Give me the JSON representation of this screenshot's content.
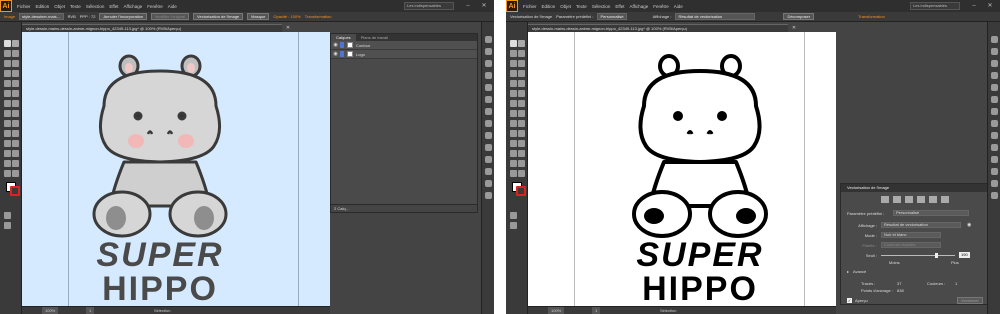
{
  "left": {
    "app_logo": "Ai",
    "menu": [
      "Fichier",
      "Edition",
      "Objet",
      "Texte",
      "Sélection",
      "Effet",
      "Affichage",
      "Fenêtre",
      "Aide"
    ],
    "workspace": "Les indispensables",
    "control": {
      "label": "Image",
      "filename": "style-dessiner-mais…",
      "color_mode": "RVB",
      "ppi": "PPP : 72",
      "btn_annuler": "Annuler l'incorporation",
      "btn_modifier": "Modifier l'original",
      "btn_vector": "Vectorisation de l'image",
      "btn_masque": "Masque",
      "opacity": "Opacité : 100%",
      "transform": "Transformation"
    },
    "doc_tab": "style-dessin-mains-dessin-anime-mignon-hippo_42349-113.jpg* @ 100% (RVB/Aperçu)",
    "status": {
      "zoom": "100%",
      "page": "1",
      "tool": "Sélection"
    },
    "layers_panel": {
      "tabs": [
        "Calques",
        "Plans de travail"
      ],
      "rows": [
        "Contour",
        "Logo"
      ],
      "footer": "2 Calq…"
    },
    "art_text": [
      "SUPER",
      "HIPPO"
    ]
  },
  "right": {
    "control": {
      "label": "Vectorisation de l'image",
      "preset_label": "Paramètre prédéfini :",
      "preset_value": "Personnalisé",
      "view_label": "Affichage :",
      "view_value": "Résultat de vectorisation",
      "btn_decomposer": "Décomposer",
      "transform": "Transformation"
    },
    "doc_tab": "style-dessin-mains-dessin-anime-mignon-hippo_42349-113.jpg* @ 100% (RVB/Aperçu)",
    "status": {
      "zoom": "100%",
      "page": "1",
      "tool": "Sélection"
    },
    "trace_panel": {
      "title": "Vectorisation de l'image",
      "preset_label": "Paramètre prédéfini :",
      "preset_value": "Personnalisé",
      "view_label": "Affichage :",
      "view_value": "Résultat de vectorisation",
      "mode_label": "Mode :",
      "mode_value": "Noir et blanc",
      "palette_label": "Palette :",
      "palette_value": "Couleurs réduites",
      "threshold_label": "Seuil :",
      "threshold_value": "190",
      "threshold_min": "Moins",
      "threshold_max": "Plus",
      "advanced": "Avancé",
      "paths_label": "Tracés :",
      "paths_value": "37",
      "colors_label": "Couleurs :",
      "colors_value": "1",
      "anchors_label": "Points d'ancrage :",
      "anchors_value": "838",
      "preview_label": "Aperçu",
      "btn_vectoriser": "Vectoriser"
    },
    "art_text": [
      "SUPER",
      "HIPPO"
    ]
  }
}
